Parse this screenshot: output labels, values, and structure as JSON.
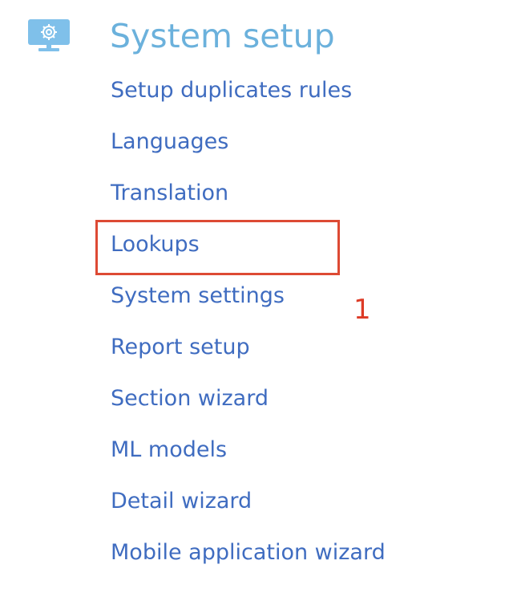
{
  "section": {
    "icon": "monitor-gear-icon",
    "title": "System setup"
  },
  "menu": {
    "items": [
      {
        "label": "Setup duplicates rules"
      },
      {
        "label": "Languages"
      },
      {
        "label": "Translation"
      },
      {
        "label": "Lookups"
      },
      {
        "label": "System settings"
      },
      {
        "label": "Report setup"
      },
      {
        "label": "Section wizard"
      },
      {
        "label": "ML models"
      },
      {
        "label": "Detail wizard"
      },
      {
        "label": "Mobile application wizard"
      }
    ],
    "highlighted": "Lookups"
  },
  "annotation": {
    "step_number": "1"
  },
  "colors": {
    "title": "#6bb1dc",
    "link": "#3f6cc0",
    "icon": "#7fc0ea",
    "highlight": "#dd4a34"
  }
}
